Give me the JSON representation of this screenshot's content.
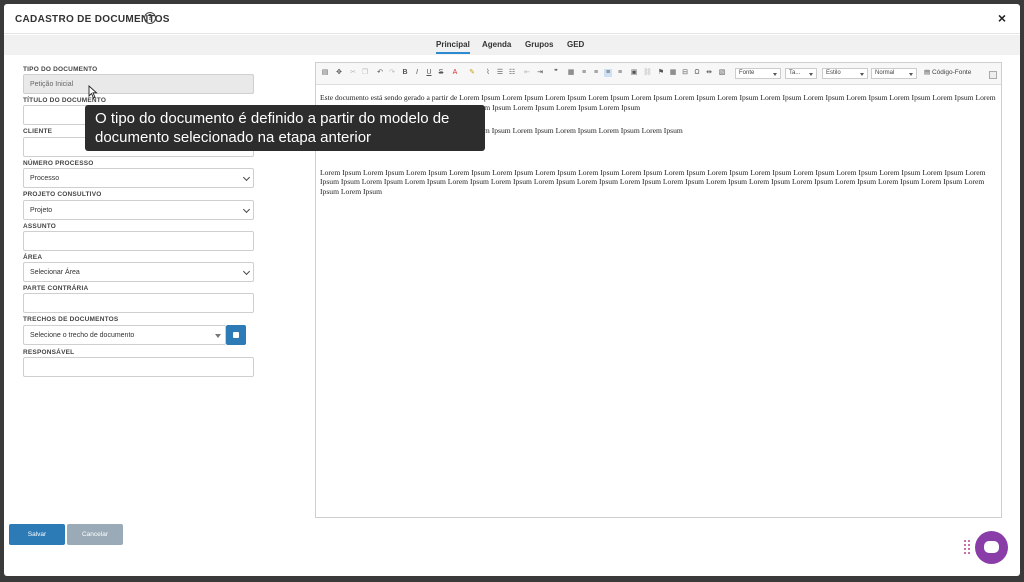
{
  "modal": {
    "title": "CADASTRO DE DOCUMENTOS",
    "help_icon": "?",
    "close_icon": "×"
  },
  "tabs": [
    {
      "label": "Principal",
      "active": true
    },
    {
      "label": "Agenda",
      "active": false
    },
    {
      "label": "Grupos",
      "active": false
    },
    {
      "label": "GED",
      "active": false
    }
  ],
  "form": {
    "tipo_label": "TIPO DO DOCUMENTO",
    "tipo_value": "Petição Inicial",
    "titulo_label": "TÍTULO DO DOCUMENTO",
    "cliente_label": "CLIENTE",
    "numero_label": "NÚMERO PROCESSO",
    "numero_value": "Processo",
    "projeto_label": "PROJETO CONSULTIVO",
    "projeto_value": "Projeto",
    "assunto_label": "ASSUNTO",
    "area_label": "ÁREA",
    "area_value": "Selecionar Área",
    "parte_label": "PARTE CONTRÁRIA",
    "trechos_label": "TRECHOS DE DOCUMENTOS",
    "trechos_value": "Selecione o trecho de documento",
    "responsavel_label": "RESPONSÁVEL"
  },
  "toolbar": {
    "fonte": "Fonte",
    "tamanho": "Ta...",
    "estilo": "Estilo",
    "formato": "Normal",
    "codigo_fonte": "Código-Fonte"
  },
  "editor": {
    "para1": "Este documento está sendo gerado a partir de Lorem Ipsum  Lorem Ipsum  Lorem Ipsum  Lorem Ipsum  Lorem Ipsum  Lorem Ipsum  Lorem Ipsum  Lorem Ipsum  Lorem Ipsum  Lorem Ipsum  Lorem Ipsum  Lorem Ipsum  Lorem Ipsum  Lorem Ipsum  Lorem Ipsum  Lorem Ipsum  Lorem Ipsum  Lorem Ipsum  Lorem Ipsum  Lorem Ipsum",
    "para2": "rem Ipsum  Lorem Ipsum  Lorem Ipsum  Lorem Ipsum  Lorem Ipsum",
    "para3": " Lorem Ipsum  Lorem Ipsum  Lorem Ipsum  Lorem Ipsum  Lorem Ipsum  Lorem Ipsum  Lorem Ipsum  Lorem Ipsum  Lorem Ipsum  Lorem Ipsum  Lorem Ipsum  Lorem Ipsum  Lorem Ipsum  Lorem Ipsum  Lorem Ipsum  Lorem Ipsum  Ipsum  Lorem Ipsum  Lorem Ipsum  Lorem Ipsum  Lorem Ipsum  Lorem Ipsum  Lorem Ipsum  Lorem Ipsum  Lorem Ipsum  Lorem Ipsum  Lorem Ipsum  Lorem Ipsum  Lorem Ipsum  Lorem Ipsum  Lorem Ipsum  Lorem Ipsum  Lorem Ipsum"
  },
  "tooltip": {
    "text": "O tipo do documento é definido a partir do modelo de documento selecionado na etapa anterior"
  },
  "actions": {
    "save": "Salvar",
    "cancel": "Cancelar"
  },
  "colors": {
    "primary": "#2c7bb6",
    "chat": "#8a3ca8"
  }
}
